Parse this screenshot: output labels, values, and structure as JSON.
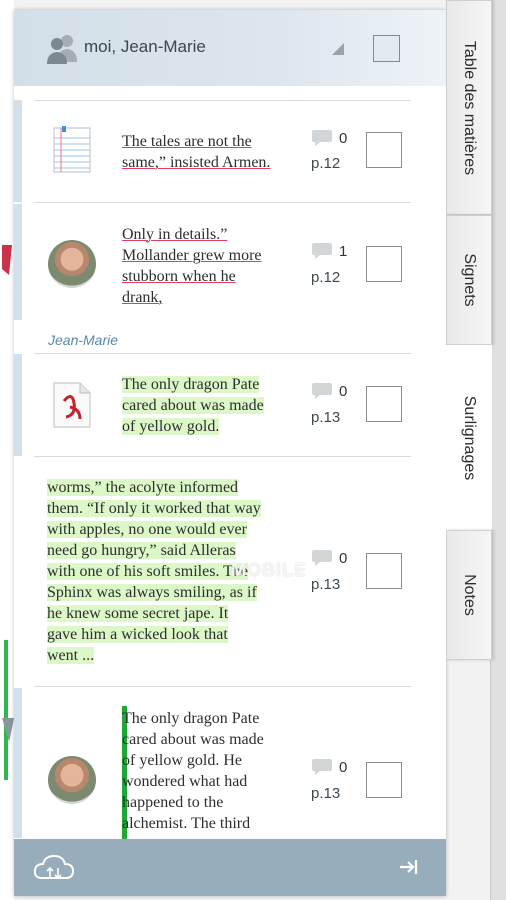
{
  "header": {
    "user_name": "moi, Jean-Marie"
  },
  "items": [
    {
      "thumb": "notepad-icon",
      "quote_lines": [
        "The tales are not the",
        "same,” insisted Armen."
      ],
      "comments": "0",
      "page": "p.12"
    },
    {
      "thumb": "avatar",
      "quote_lines": [
        "Only in details.”",
        "Mollander grew more",
        "stubborn when he",
        "drank,"
      ],
      "comments": "1",
      "page": "p.12"
    },
    {
      "thumb": "pdf-icon",
      "quote_lines": [
        "The only dragon Pate",
        "cared about was made",
        "of yellow gold."
      ],
      "comments": "0",
      "page": "p.13"
    },
    {
      "thumb": "",
      "quote_lines": [
        "worms,” the acolyte informed",
        "them. “If only it worked that way",
        "with apples, no one would ever",
        "need go hungry,” said Alleras",
        "with one of his soft smiles. The",
        "Sphinx was always smiling, as if",
        "he knew some secret jape. It",
        "gave him a wicked look that",
        "went ..."
      ],
      "comments": "0",
      "page": "p.13"
    },
    {
      "thumb": "avatar",
      "quote_lines": [
        "The only dragon Pate",
        "cared about was made",
        "of yellow gold. He",
        "wondered what had",
        "happened to the",
        "alchemist. The third"
      ],
      "comments": "0",
      "page": "p.13"
    }
  ],
  "section_label": "Jean-Marie",
  "watermark": "MOBILE",
  "tabs": [
    "Table des matières",
    "Signets",
    "Surlignages",
    "Notes"
  ],
  "colors": {
    "header_bg": "#d3dfe8",
    "footer_bg": "#98adbc",
    "underline": "#e23c64",
    "highlight": "#dcf8c8",
    "section": "#5b88a8"
  }
}
